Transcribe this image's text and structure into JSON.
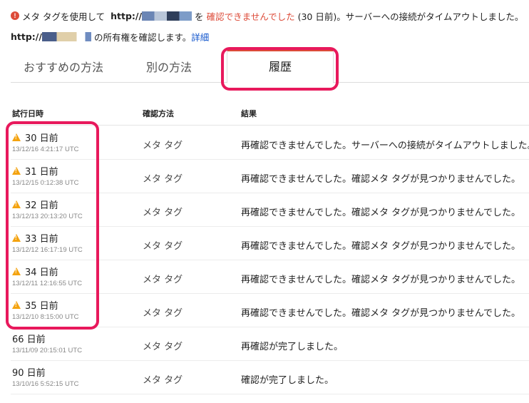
{
  "alert": {
    "text_before": "メタ タグを使用して",
    "url_prefix": "http://",
    "text_mid": "を",
    "error_text": "確認できませんでした",
    "text_after": "(30 日前)。サーバーへの接続がタイムアウトしました。"
  },
  "ownership": {
    "url_prefix": "http://",
    "text": "の所有権を確認します。",
    "link": "詳細"
  },
  "tabs": [
    {
      "label": "おすすめの方法"
    },
    {
      "label": "別の方法"
    },
    {
      "label": "履歴"
    }
  ],
  "table": {
    "headers": [
      "試行日時",
      "確認方法",
      "結果"
    ],
    "rows": [
      {
        "when": "30 日前",
        "ts": "13/12/16 4:21:17 UTC",
        "method": "メタ タグ",
        "result": "再確認できませんでした。サーバーへの接続がタイムアウトしました。",
        "warning": true
      },
      {
        "when": "31 日前",
        "ts": "13/12/15 0:12:38 UTC",
        "method": "メタ タグ",
        "result": "再確認できませんでした。確認メタ タグが見つかりませんでした。",
        "warning": true
      },
      {
        "when": "32 日前",
        "ts": "13/12/13 20:13:20 UTC",
        "method": "メタ タグ",
        "result": "再確認できませんでした。確認メタ タグが見つかりませんでした。",
        "warning": true
      },
      {
        "when": "33 日前",
        "ts": "13/12/12 16:17:19 UTC",
        "method": "メタ タグ",
        "result": "再確認できませんでした。確認メタ タグが見つかりませんでした。",
        "warning": true
      },
      {
        "when": "34 日前",
        "ts": "13/12/11 12:16:55 UTC",
        "method": "メタ タグ",
        "result": "再確認できませんでした。確認メタ タグが見つかりませんでした。",
        "warning": true
      },
      {
        "when": "35 日前",
        "ts": "13/12/10 8:15:00 UTC",
        "method": "メタ タグ",
        "result": "再確認できませんでした。確認メタ タグが見つかりませんでした。",
        "warning": true
      },
      {
        "when": "66 日前",
        "ts": "13/11/09 20:15:01 UTC",
        "method": "メタ タグ",
        "result": "再確認が完了しました。",
        "warning": false
      },
      {
        "when": "90 日前",
        "ts": "13/10/16 5:52:15 UTC",
        "method": "メタ タグ",
        "result": "確認が完了しました。",
        "warning": false
      }
    ]
  },
  "colors": {
    "error": "#dd4b39",
    "warning": "#f4a30f",
    "highlight": "#e8195c",
    "link": "#1155cc"
  }
}
